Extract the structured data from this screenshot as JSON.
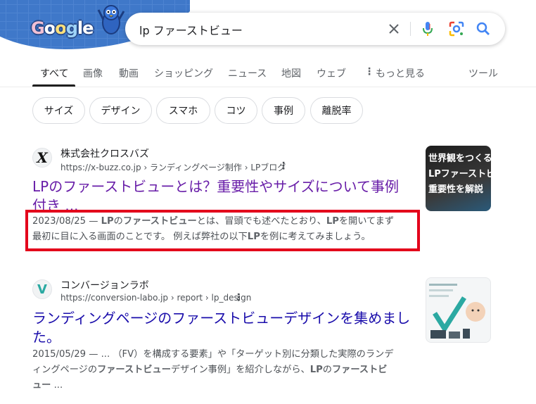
{
  "doodle": {
    "logo_letters": [
      "G",
      "o",
      "o",
      "g",
      "l",
      "e"
    ]
  },
  "search": {
    "query": "lp ファーストビュー",
    "icons": [
      "close-icon",
      "mic-icon",
      "lens-icon",
      "search-icon"
    ]
  },
  "tabs": [
    {
      "label": "すべて",
      "active": true
    },
    {
      "label": "画像"
    },
    {
      "label": "動画"
    },
    {
      "label": "ショッピング"
    },
    {
      "label": "ニュース"
    },
    {
      "label": "地図"
    },
    {
      "label": "ウェブ"
    },
    {
      "label": "もっと見る"
    }
  ],
  "tools_label": "ツール",
  "chips": [
    "サイズ",
    "デザイン",
    "スマホ",
    "コツ",
    "事例",
    "離脱率"
  ],
  "results": [
    {
      "site_name": "株式会社クロスバズ",
      "url": "https://x-buzz.co.jp › ランディングページ制作 › LPブログ",
      "title_line1": "LPのファーストビューとは？重要性やサイズについて事例",
      "title_line2": "付き ...",
      "snippet_line1_parts": [
        "2023/08/25 — ",
        "LP",
        "の",
        "ファーストビュー",
        "とは、冒頭でも述べたとおり、",
        "LP",
        "を開いてまず"
      ],
      "snippet_line2_parts": [
        "最初に目に入る画面のことです。 例えば弊社の以下",
        "LP",
        "を例に考えてみましょう。"
      ],
      "thumb_text": [
        "世界観をつくる",
        "LPファーストビュ",
        "重要性を解説"
      ],
      "favicon_letter": "X"
    },
    {
      "site_name": "コンバージョンラボ",
      "url": "https://conversion-labo.jp › report › lp_design",
      "title_line1": "ランディングページのファーストビューデザインを集めまし",
      "title_line2": "た。",
      "snippet_line1": "2015/05/29 — ... （FV）を構成する要素」や「ターゲット別に分類した実際のランデ",
      "snippet_line2_parts": [
        "ィングページの",
        "ファーストビュー",
        "デザイン事例」を紹介しながら、",
        "LP",
        "の",
        "ファーストビ"
      ],
      "snippet_line3_parts": [
        "ュー",
        " ..."
      ],
      "favicon_letter": "V"
    }
  ],
  "colors": {
    "visited_link": "#681da8",
    "link": "#1a0dab",
    "highlight": "#e3001b"
  }
}
